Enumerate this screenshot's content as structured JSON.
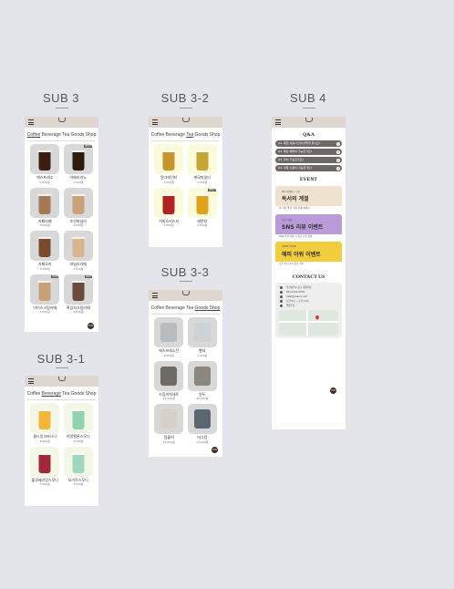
{
  "sections": {
    "sub3": "SUB 3",
    "sub3_1": "SUB 3-1",
    "sub3_2": "SUB 3-2",
    "sub3_3": "SUB 3-3",
    "sub4": "SUB 4"
  },
  "tabs": [
    "Coffee",
    "Beverage",
    "Tea",
    "Goods Shop"
  ],
  "sub3": {
    "products": [
      {
        "name": "에스프레소",
        "price": "2,000원",
        "color": "#3a1f10"
      },
      {
        "name": "아메리카노",
        "price": "2,000원",
        "color": "#2e1b10",
        "badge": "BEST"
      },
      {
        "name": "카페라떼",
        "price": "3,000원",
        "color": "#a47a55"
      },
      {
        "name": "조선바닐라",
        "price": "3,000원",
        "color": "#c9a27a"
      },
      {
        "name": "카페모카",
        "price": "3,500원",
        "color": "#7a4a2f"
      },
      {
        "name": "바닐라라떼",
        "price": "3,500원",
        "color": "#d9b48c"
      },
      {
        "name": "아이스크림라떼",
        "price": "3,500원",
        "color": "#c7a07a",
        "badge": "NEW"
      },
      {
        "name": "흑임자크림라떼",
        "price": "4,000원",
        "color": "#6b4a3b",
        "badge": "NEW"
      }
    ],
    "top": "TOP"
  },
  "sub3_1": {
    "products": [
      {
        "name": "콜드망고바나나",
        "price": "3,000원",
        "color": "#f2b63a"
      },
      {
        "name": "리얼멜론스무디",
        "price": "3,500원",
        "color": "#8fd4b0"
      },
      {
        "name": "블루베리맛스무디",
        "price": "3,500원",
        "color": "#a3263b"
      },
      {
        "name": "요거트스무디",
        "price": "3,500원",
        "color": "#9ed8be"
      }
    ]
  },
  "sub3_2": {
    "products": [
      {
        "name": "얼그레이티",
        "price": "2,000원",
        "color": "#c7962a"
      },
      {
        "name": "캐모마일티",
        "price": "2,000원",
        "color": "#c7a536"
      },
      {
        "name": "히비스커스티",
        "price": "2,000원",
        "color": "#b32222"
      },
      {
        "name": "레몬티",
        "price": "2,500원",
        "color": "#e0a21a",
        "badge": "BEST"
      }
    ]
  },
  "sub3_3": {
    "products": [
      {
        "name": "에스프레소잔",
        "price": "9,900원",
        "color": "#b8bcbf"
      },
      {
        "name": "빨대",
        "price": "1,000원",
        "color": "#cfd2d4"
      },
      {
        "name": "드립커피세트",
        "price": "12,000원",
        "color": "#6e6a66"
      },
      {
        "name": "원두",
        "price": "15,000원",
        "color": "#8c8680"
      },
      {
        "name": "텀블러",
        "price": "25,000원",
        "color": "#d6d0c8"
      },
      {
        "name": "머그컵",
        "price": "12,000원",
        "color": "#5a6670"
      }
    ]
  },
  "sub4": {
    "qa_title": "Q&A",
    "qa_items": [
      "Q1. 매장 이용시간이 어떻게 되나요?",
      "Q2. 메뉴 예약이 가능한가요?",
      "Q3. 주차 가능한가요?",
      "Q4. 쿠폰 사용이 가능한가요?"
    ],
    "event_title": "EVENT",
    "events": [
      {
        "small": "책과 함께하는 시간",
        "big": "독서의 계절",
        "desc": "이 가을 책 한 권과 함께 하세요.",
        "bg": "#efe3cf"
      },
      {
        "small": "리뷰 이벤트",
        "big": "SNS 리뷰 이벤트",
        "desc": "SNS 리뷰 작성 시 음료 쿠폰 증정",
        "bg": "#b99bd8"
      },
      {
        "small": "HAPPY HOUR",
        "big": "해피 아워 이벤트",
        "desc": "오후 3시~5시 음료 할인",
        "bg": "#f2cd3e"
      }
    ],
    "contact_title": "CONTACT US",
    "contacts": [
      "부산광역시 동구 중앙대로",
      "051-1234-5678",
      "cafe@joseon.com",
      "오전 8시 ~ 오후 10시",
      "연중무휴"
    ],
    "top": "TOP"
  }
}
